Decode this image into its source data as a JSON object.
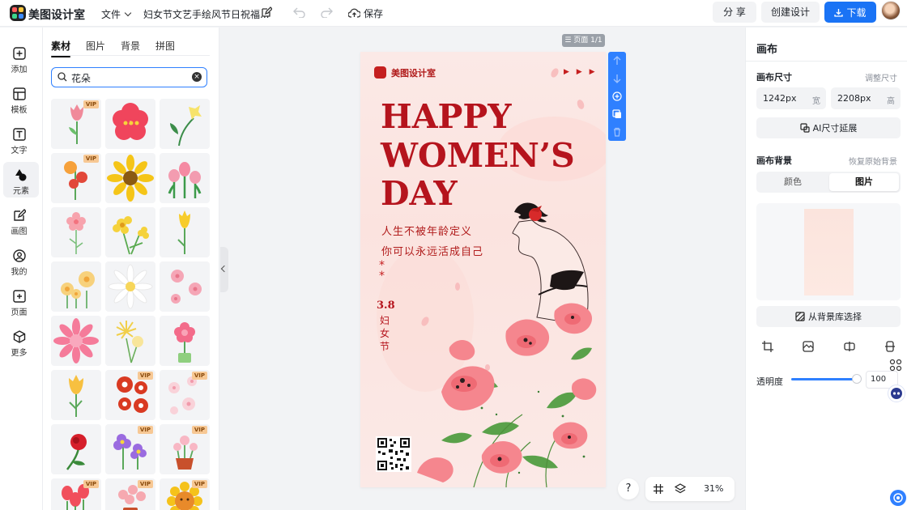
{
  "app": {
    "logo_text": "美图设计室",
    "menu_file": "文件",
    "doc_title": "妇女节文艺手绘风节日祝福...",
    "save_label": "保存"
  },
  "header": {
    "share_label": "分 享",
    "create_label": "创建设计",
    "download_label": "下载"
  },
  "rail": {
    "items": [
      {
        "label": "添加",
        "icon": "plus-square-icon"
      },
      {
        "label": "模板",
        "icon": "template-icon"
      },
      {
        "label": "文字",
        "icon": "text-icon"
      },
      {
        "label": "元素",
        "icon": "shapes-icon"
      },
      {
        "label": "画图",
        "icon": "pencil-icon"
      },
      {
        "label": "我的",
        "icon": "user-icon"
      },
      {
        "label": "页面",
        "icon": "page-add-icon"
      },
      {
        "label": "更多",
        "icon": "cube-icon"
      }
    ],
    "active": 3
  },
  "panel": {
    "tabs": [
      "素材",
      "图片",
      "背景",
      "拼图"
    ],
    "active_tab": 0,
    "search_value": "花朵",
    "vip_label": "VIP"
  },
  "canvas": {
    "page_label": "☰ 页面 1/1",
    "zoom": "31%",
    "help": "?"
  },
  "poster": {
    "brand": "美图设计室",
    "arrows": "▶ ▶ ▶",
    "headline_1": "HAPPY",
    "headline_2": "WOMEN’S",
    "headline_3": "DAY",
    "sub_1": "人生不被年龄定义",
    "sub_2": "你可以永远活成自己",
    "stars": "*\n*",
    "date_num": "3.8",
    "date_cn": "妇女节",
    "colors": {
      "accent": "#b5141d",
      "background": "#fbe9e6"
    }
  },
  "props": {
    "title": "画布",
    "size_section": "画布尺寸",
    "size_link": "调整尺寸",
    "width_value": "1242px",
    "width_unit": "宽",
    "height_value": "2208px",
    "height_unit": "高",
    "ai_extend_label": "AI尺寸延展",
    "bg_section": "画布背景",
    "bg_link": "恢复原始背景",
    "seg_color": "颜色",
    "seg_image": "图片",
    "bg_library_label": "从背景库选择",
    "opacity_label": "透明度",
    "opacity_value": "100",
    "opacity_fraction": 1.0
  },
  "colors": {
    "primary": "#1a73f5",
    "panel_bg": "#f2f3f5"
  }
}
